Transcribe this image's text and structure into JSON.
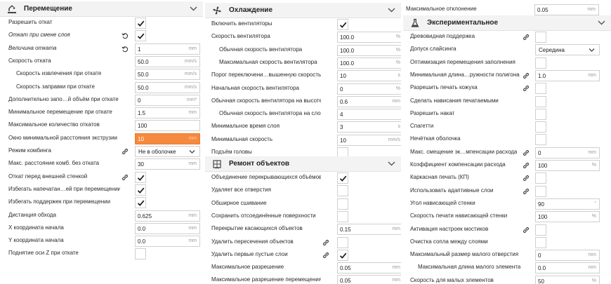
{
  "travel": {
    "title": "Перемещение",
    "icon": "travel-icon",
    "rows": [
      {
        "label": "Разрешить откат",
        "type": "check",
        "checked": true
      },
      {
        "label": "Откат при смене слоя",
        "type": "check",
        "checked": true,
        "italic": true,
        "reset": true
      },
      {
        "label": "Величина отката",
        "type": "field",
        "value": "1",
        "unit": "mm",
        "italic": true,
        "reset": true
      },
      {
        "label": "Скорость отката",
        "type": "field",
        "value": "50.0",
        "unit": "mm/s"
      },
      {
        "label": "Скорость извлечения при откате",
        "type": "field",
        "value": "50.0",
        "unit": "mm/s",
        "indent": 1
      },
      {
        "label": "Скорость заправки при откате",
        "type": "field",
        "value": "50.0",
        "unit": "mm/s",
        "indent": 1
      },
      {
        "label": "Дополнительно запо…й объём при откате",
        "type": "field",
        "value": "0",
        "unit": "mm³"
      },
      {
        "label": "Минимальное перемещение при откате",
        "type": "field",
        "value": "1.5",
        "unit": "mm"
      },
      {
        "label": "Максимальное количество откатов",
        "type": "field",
        "value": "100",
        "unit": ""
      },
      {
        "label": "Окно минимальной расстояния экструзии",
        "type": "field",
        "value": "10",
        "unit": "mm",
        "warn": true
      },
      {
        "label": "Режим комбинга",
        "type": "combo",
        "value": "Не в оболочке",
        "link": true
      },
      {
        "label": "Макс. расстояние комб. без отката",
        "type": "field",
        "value": "30",
        "unit": "mm"
      },
      {
        "label": "Откат перед внешней стенкой",
        "type": "check",
        "checked": true,
        "link": true
      },
      {
        "label": "Избегать напечатан…ей при перемещении",
        "type": "check",
        "checked": true
      },
      {
        "label": "Избегать поддержек при перемещении",
        "type": "check",
        "checked": true
      },
      {
        "label": "Дистанция обхода",
        "type": "field",
        "value": "0.625",
        "unit": "mm"
      },
      {
        "label": "X координата начала",
        "type": "field",
        "value": "0.0",
        "unit": "mm"
      },
      {
        "label": "Y координата начала",
        "type": "field",
        "value": "0.0",
        "unit": "mm"
      },
      {
        "label": "Поднятие оси Z при откате",
        "type": "check",
        "checked": false
      }
    ]
  },
  "cooling": {
    "title": "Охлаждение",
    "icon": "fan-icon",
    "rows": [
      {
        "label": "Включить вентиляторы",
        "type": "check",
        "checked": true
      },
      {
        "label": "Скорость вентилятора",
        "type": "field",
        "value": "100.0",
        "unit": "%"
      },
      {
        "label": "Обычная скорость вентилятора",
        "type": "field",
        "value": "100.0",
        "unit": "%",
        "indent": 1
      },
      {
        "label": "Максимальная скорость вентилятора",
        "type": "field",
        "value": "100.0",
        "unit": "%",
        "indent": 1
      },
      {
        "label": "Порог переключени…вышенную скорость",
        "type": "field",
        "value": "10",
        "unit": "s"
      },
      {
        "label": "Начальная скорость вентилятора",
        "type": "field",
        "value": "0",
        "unit": "%"
      },
      {
        "label": "Обычная скорость вентилятора на высоте",
        "type": "field",
        "value": "0.6",
        "unit": "mm"
      },
      {
        "label": "Обычная скорость вентилятора на слое",
        "type": "field",
        "value": "4",
        "unit": "",
        "indent": 1
      },
      {
        "label": "Минимальное время слоя",
        "type": "field",
        "value": "3",
        "unit": "s"
      },
      {
        "label": "Минимальная скорость",
        "type": "field",
        "value": "10",
        "unit": "mm/s"
      },
      {
        "label": "Подъём головы",
        "type": "check",
        "checked": false
      }
    ]
  },
  "mesh": {
    "title": "Ремонт объектов",
    "icon": "mesh-fix-icon",
    "rows": [
      {
        "label": "Объединение перекрывающихся объёмов",
        "type": "check",
        "checked": true
      },
      {
        "label": "Удаляет все отверстия",
        "type": "check",
        "checked": false
      },
      {
        "label": "Обширное сшивание",
        "type": "check",
        "checked": false
      },
      {
        "label": "Сохранить отсоединённые поверхности",
        "type": "check",
        "checked": false
      },
      {
        "label": "Перекрытие касающихся объектов",
        "type": "field",
        "value": "0.15",
        "unit": "mm"
      },
      {
        "label": "Удалить пересечения объектов",
        "type": "check",
        "checked": false,
        "link": true
      },
      {
        "label": "Удалить первые пустые слои",
        "type": "check",
        "checked": true,
        "link": true
      },
      {
        "label": "Максимальное разрешение",
        "type": "field",
        "value": "0.05",
        "unit": "mm"
      },
      {
        "label": "Максимальное разрешение перемещения",
        "type": "field",
        "value": "0.05",
        "unit": "mm"
      }
    ]
  },
  "top_right": {
    "label": "Максимальное отклонение",
    "value": "0.05",
    "unit": "mm"
  },
  "experimental": {
    "title": "Экспериментальное",
    "icon": "flask-icon",
    "rows": [
      {
        "label": "Древовидная поддержка",
        "type": "check",
        "checked": false,
        "link": true
      },
      {
        "label": "Допуск слайсинга",
        "type": "combo",
        "value": "Середина"
      },
      {
        "label": "Оптимизация перемещения заполнения",
        "type": "check",
        "checked": false
      },
      {
        "label": "Минимальная длина…ружности полигона",
        "type": "field",
        "value": "1.0",
        "unit": "mm",
        "link": true
      },
      {
        "label": "Разрешить печать кожуха",
        "type": "check",
        "checked": false,
        "link": true
      },
      {
        "label": "Сделать нависания печатаемыми",
        "type": "check",
        "checked": false
      },
      {
        "label": "Разрешить накат",
        "type": "check",
        "checked": false
      },
      {
        "label": "Спагетти",
        "type": "check",
        "checked": false
      },
      {
        "label": "Нечёткая оболочка",
        "type": "check",
        "checked": false
      },
      {
        "label": "Макс. смещение эк…мпенсации расхода",
        "type": "field",
        "value": "0",
        "unit": "mm",
        "link": true
      },
      {
        "label": "Коэффициент компенсации расхода",
        "type": "field",
        "value": "100",
        "unit": "%",
        "link": true
      },
      {
        "label": "Каркасная печать (КП)",
        "type": "check",
        "checked": false,
        "link": true
      },
      {
        "label": "Использовать адаптивные слои",
        "type": "check",
        "checked": false,
        "link": true
      },
      {
        "label": "Угол нависающей стенки",
        "type": "field",
        "value": "90",
        "unit": "°"
      },
      {
        "label": "Скорость печати нависающей стенки",
        "type": "field",
        "value": "100",
        "unit": "%"
      },
      {
        "label": "Активация настроек мостиков",
        "type": "check",
        "checked": false,
        "link": true
      },
      {
        "label": "Очистка сопла между слоями",
        "type": "check",
        "checked": false
      },
      {
        "label": "Максимальный размер малого отверстия",
        "type": "field",
        "value": "0",
        "unit": "mm"
      },
      {
        "label": "Максимальная длина малого элемента",
        "type": "field",
        "value": "0.0",
        "unit": "mm",
        "indent": 1
      },
      {
        "label": "Скорость для малых элементов",
        "type": "field",
        "value": "50",
        "unit": "%"
      }
    ]
  }
}
